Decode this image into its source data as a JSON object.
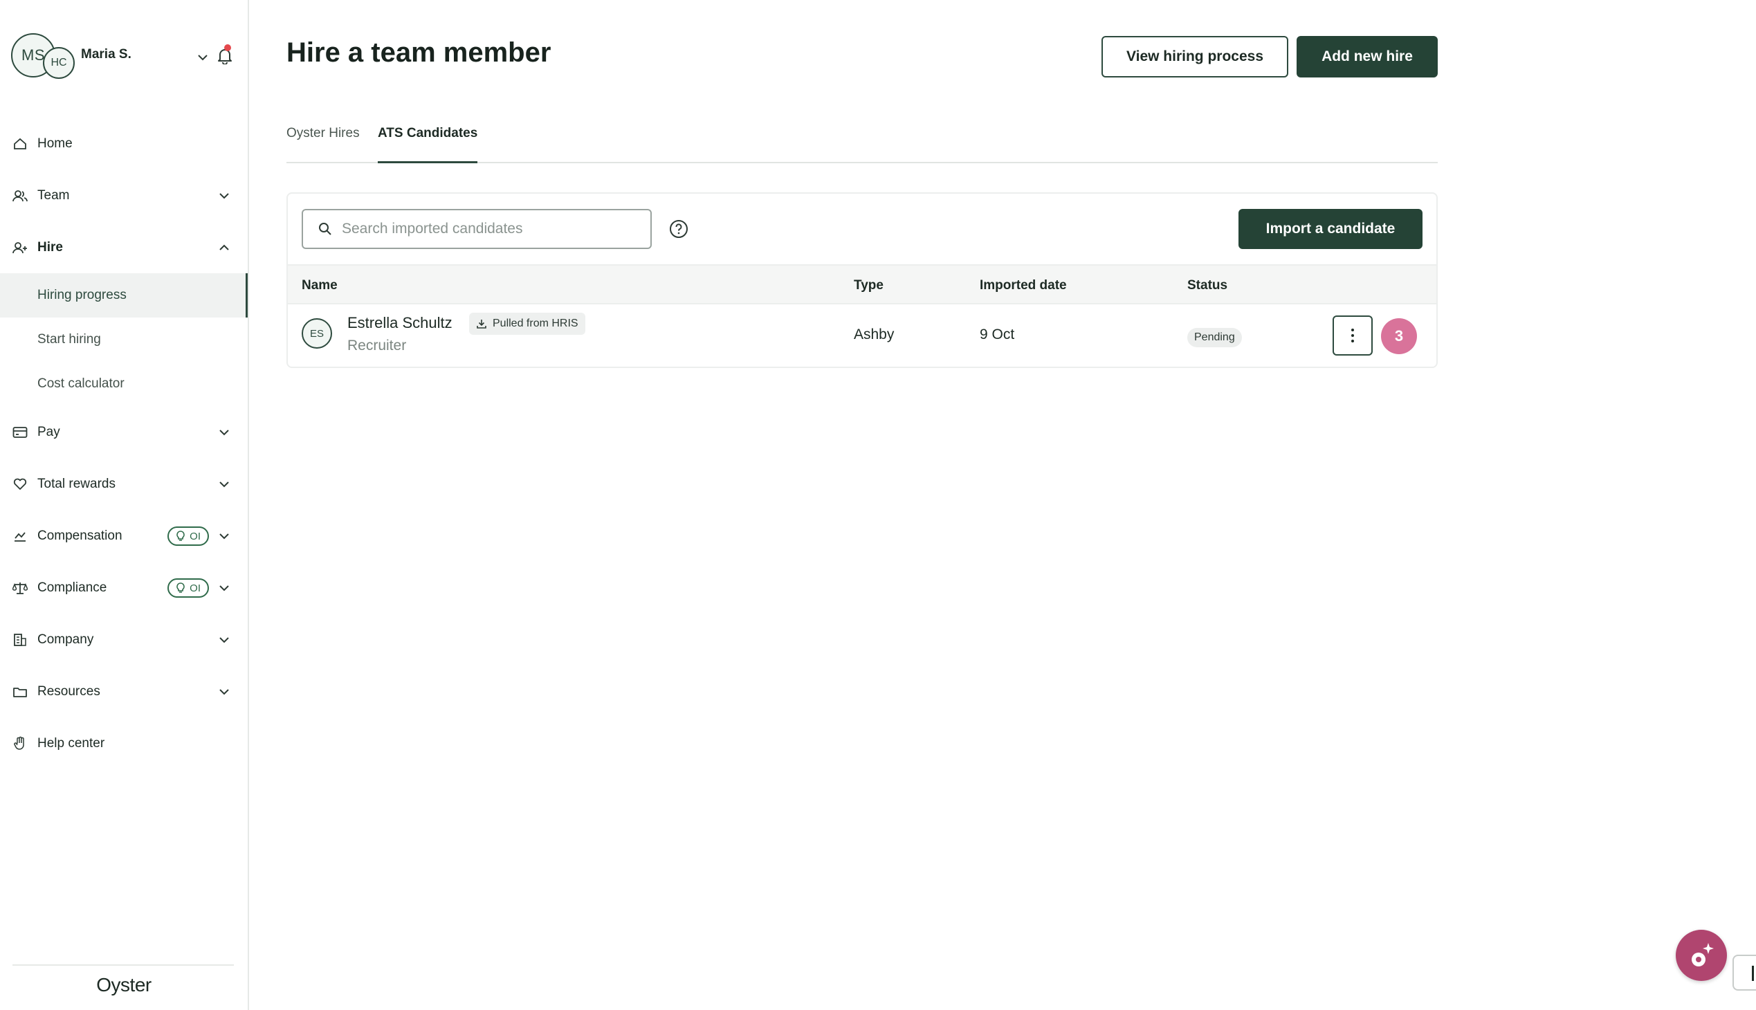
{
  "user": {
    "initials_primary": "MS",
    "initials_secondary": "HC",
    "name": "Maria S."
  },
  "nav": {
    "home": "Home",
    "team": "Team",
    "hire": "Hire",
    "hire_sub": {
      "hiring_progress": "Hiring progress",
      "start_hiring": "Start hiring",
      "cost_calculator": "Cost calculator"
    },
    "pay": "Pay",
    "total_rewards": "Total rewards",
    "compensation": "Compensation",
    "compliance": "Compliance",
    "ai_badge_label": "OI",
    "company": "Company",
    "resources": "Resources",
    "help_center": "Help center"
  },
  "brand": "Oyster",
  "page": {
    "title": "Hire a team member",
    "view_process_label": "View hiring process",
    "add_new_hire_label": "Add new hire"
  },
  "tabs": {
    "oyster_hires": "Oyster Hires",
    "ats_candidates": "ATS Candidates",
    "active": "ATS Candidates"
  },
  "search": {
    "placeholder": "Search imported candidates",
    "value": ""
  },
  "import_button_label": "Import a candidate",
  "table": {
    "headers": {
      "name": "Name",
      "type": "Type",
      "imported_date": "Imported date",
      "status": "Status"
    },
    "rows": [
      {
        "initials": "ES",
        "name": "Estrella Schultz",
        "tag": "Pulled from HRIS",
        "role": "Recruiter",
        "type": "Ashby",
        "imported_date": "9 Oct",
        "status": "Pending",
        "badge_count": "3"
      }
    ]
  },
  "colors": {
    "primary": "#254336",
    "accent_pink": "#d9739a",
    "notification_dot": "#e5484d"
  }
}
